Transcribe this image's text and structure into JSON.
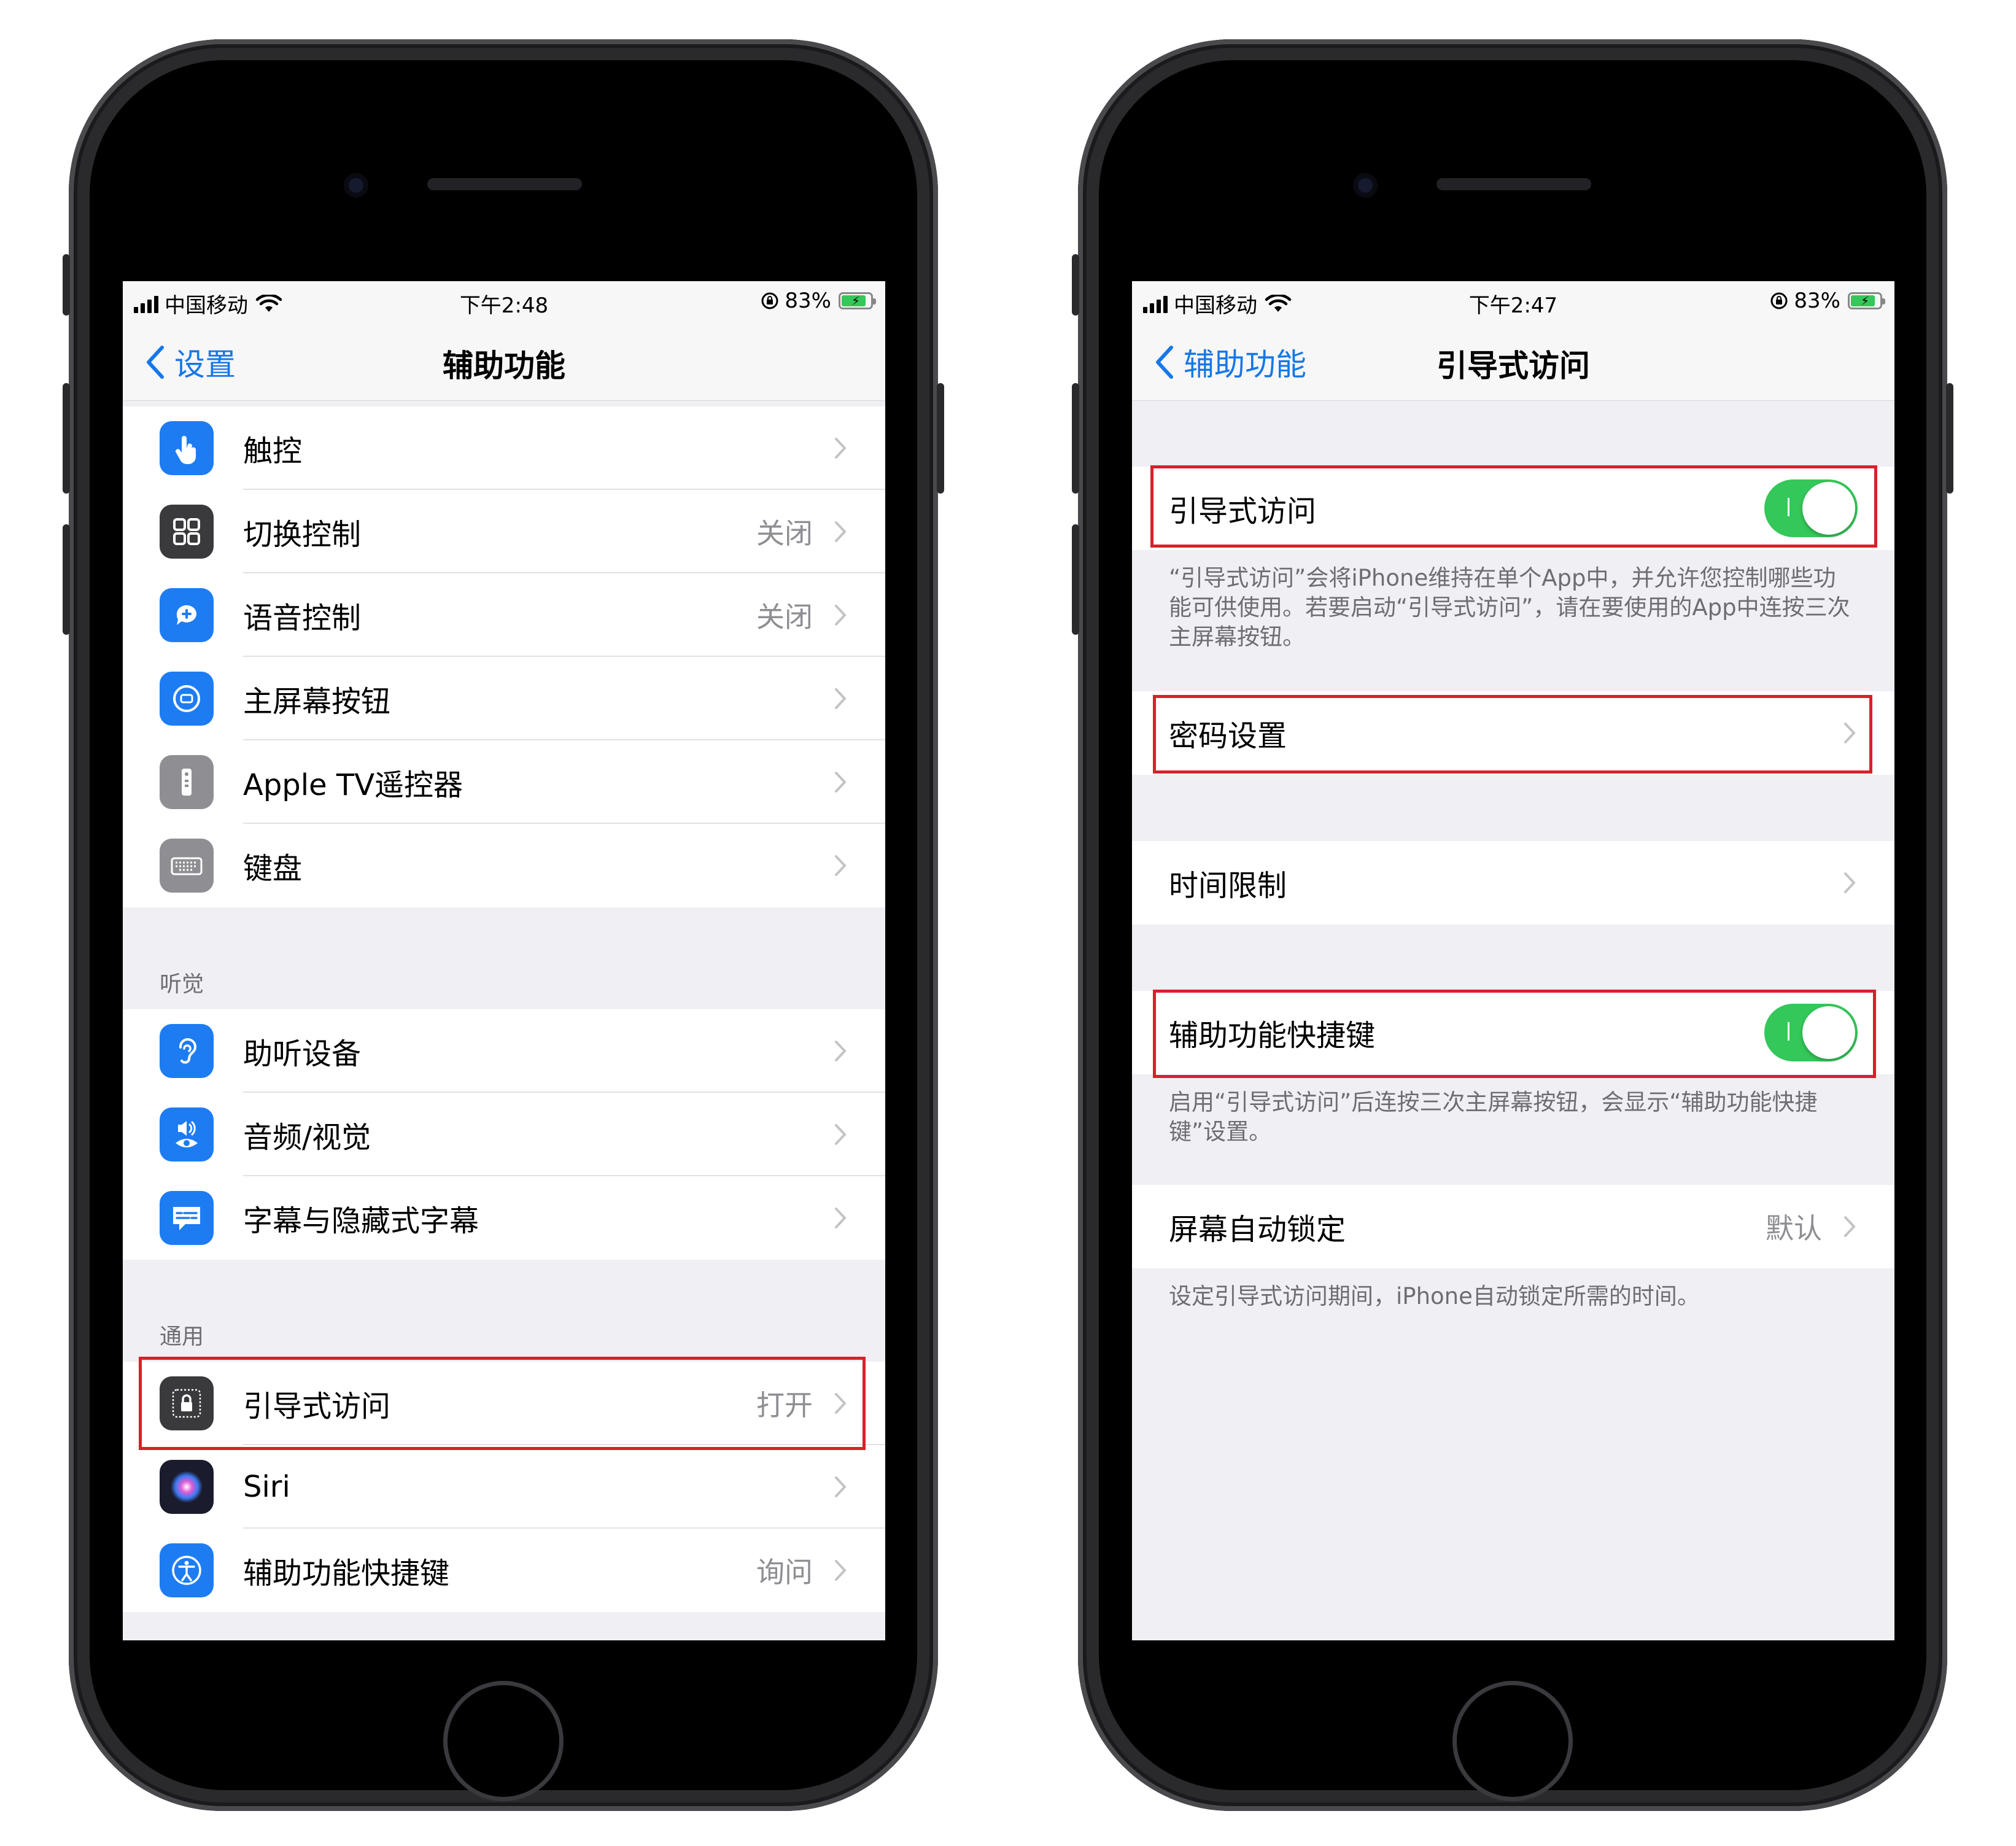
{
  "accent_color": "#1677e8",
  "highlight_color": "#d9202b",
  "left": {
    "status": {
      "carrier": "中国移动",
      "time": "下午2:48",
      "battery": "83%"
    },
    "nav": {
      "back_label": "设置",
      "title": "辅助功能"
    },
    "group1": [
      {
        "label": "触控",
        "value": "",
        "icon": "touch-hand-icon",
        "color": "#1e7cf2"
      },
      {
        "label": "切换控制",
        "value": "关闭",
        "icon": "switch-control-grid-icon",
        "color": "#3a3a3c"
      },
      {
        "label": "语音控制",
        "value": "关闭",
        "icon": "voice-control-icon",
        "color": "#1e7cf2"
      },
      {
        "label": "主屏幕按钮",
        "value": "",
        "icon": "home-button-icon",
        "color": "#1e7cf2"
      },
      {
        "label": "Apple TV遥控器",
        "value": "",
        "icon": "apple-tv-remote-icon",
        "color": "#8e8e93"
      },
      {
        "label": "键盘",
        "value": "",
        "icon": "keyboard-icon",
        "color": "#8e8e93"
      }
    ],
    "section_hearing": "听觉",
    "group2": [
      {
        "label": "助听设备",
        "value": "",
        "icon": "hearing-ear-icon",
        "color": "#1e7cf2"
      },
      {
        "label": "音频/视觉",
        "value": "",
        "icon": "audio-visual-icon",
        "color": "#1e7cf2"
      },
      {
        "label": "字幕与隐藏式字幕",
        "value": "",
        "icon": "subtitles-icon",
        "color": "#1e7cf2"
      }
    ],
    "section_general": "通用",
    "group3": [
      {
        "label": "引导式访问",
        "value": "打开",
        "icon": "guided-access-lock-icon",
        "color": "#3a3a3c"
      },
      {
        "label": "Siri",
        "value": "",
        "icon": "siri-icon",
        "color": "#1b1b2e"
      },
      {
        "label": "辅助功能快捷键",
        "value": "询问",
        "icon": "accessibility-shortcut-icon",
        "color": "#1e7cf2"
      }
    ]
  },
  "right": {
    "status": {
      "carrier": "中国移动",
      "time": "下午2:47",
      "battery": "83%"
    },
    "nav": {
      "back_label": "辅助功能",
      "title": "引导式访问"
    },
    "guided_access": {
      "label": "引导式访问",
      "enabled": true
    },
    "guided_access_note": "“引导式访问”会将iPhone维持在单个App中，并允许您控制哪些功能可供使用。若要启动“引导式访问”，请在要使用的App中连按三次主屏幕按钮。",
    "passcode_settings": "密码设置",
    "time_limits": "时间限制",
    "accessibility_shortcut": {
      "label": "辅助功能快捷键",
      "enabled": true
    },
    "shortcut_note": "启用“引导式访问”后连按三次主屏幕按钮，会显示“辅助功能快捷键”设置。",
    "auto_lock": {
      "label": "屏幕自动锁定",
      "value": "默认"
    },
    "auto_lock_note": "设定引导式访问期间，iPhone自动锁定所需的时间。"
  }
}
